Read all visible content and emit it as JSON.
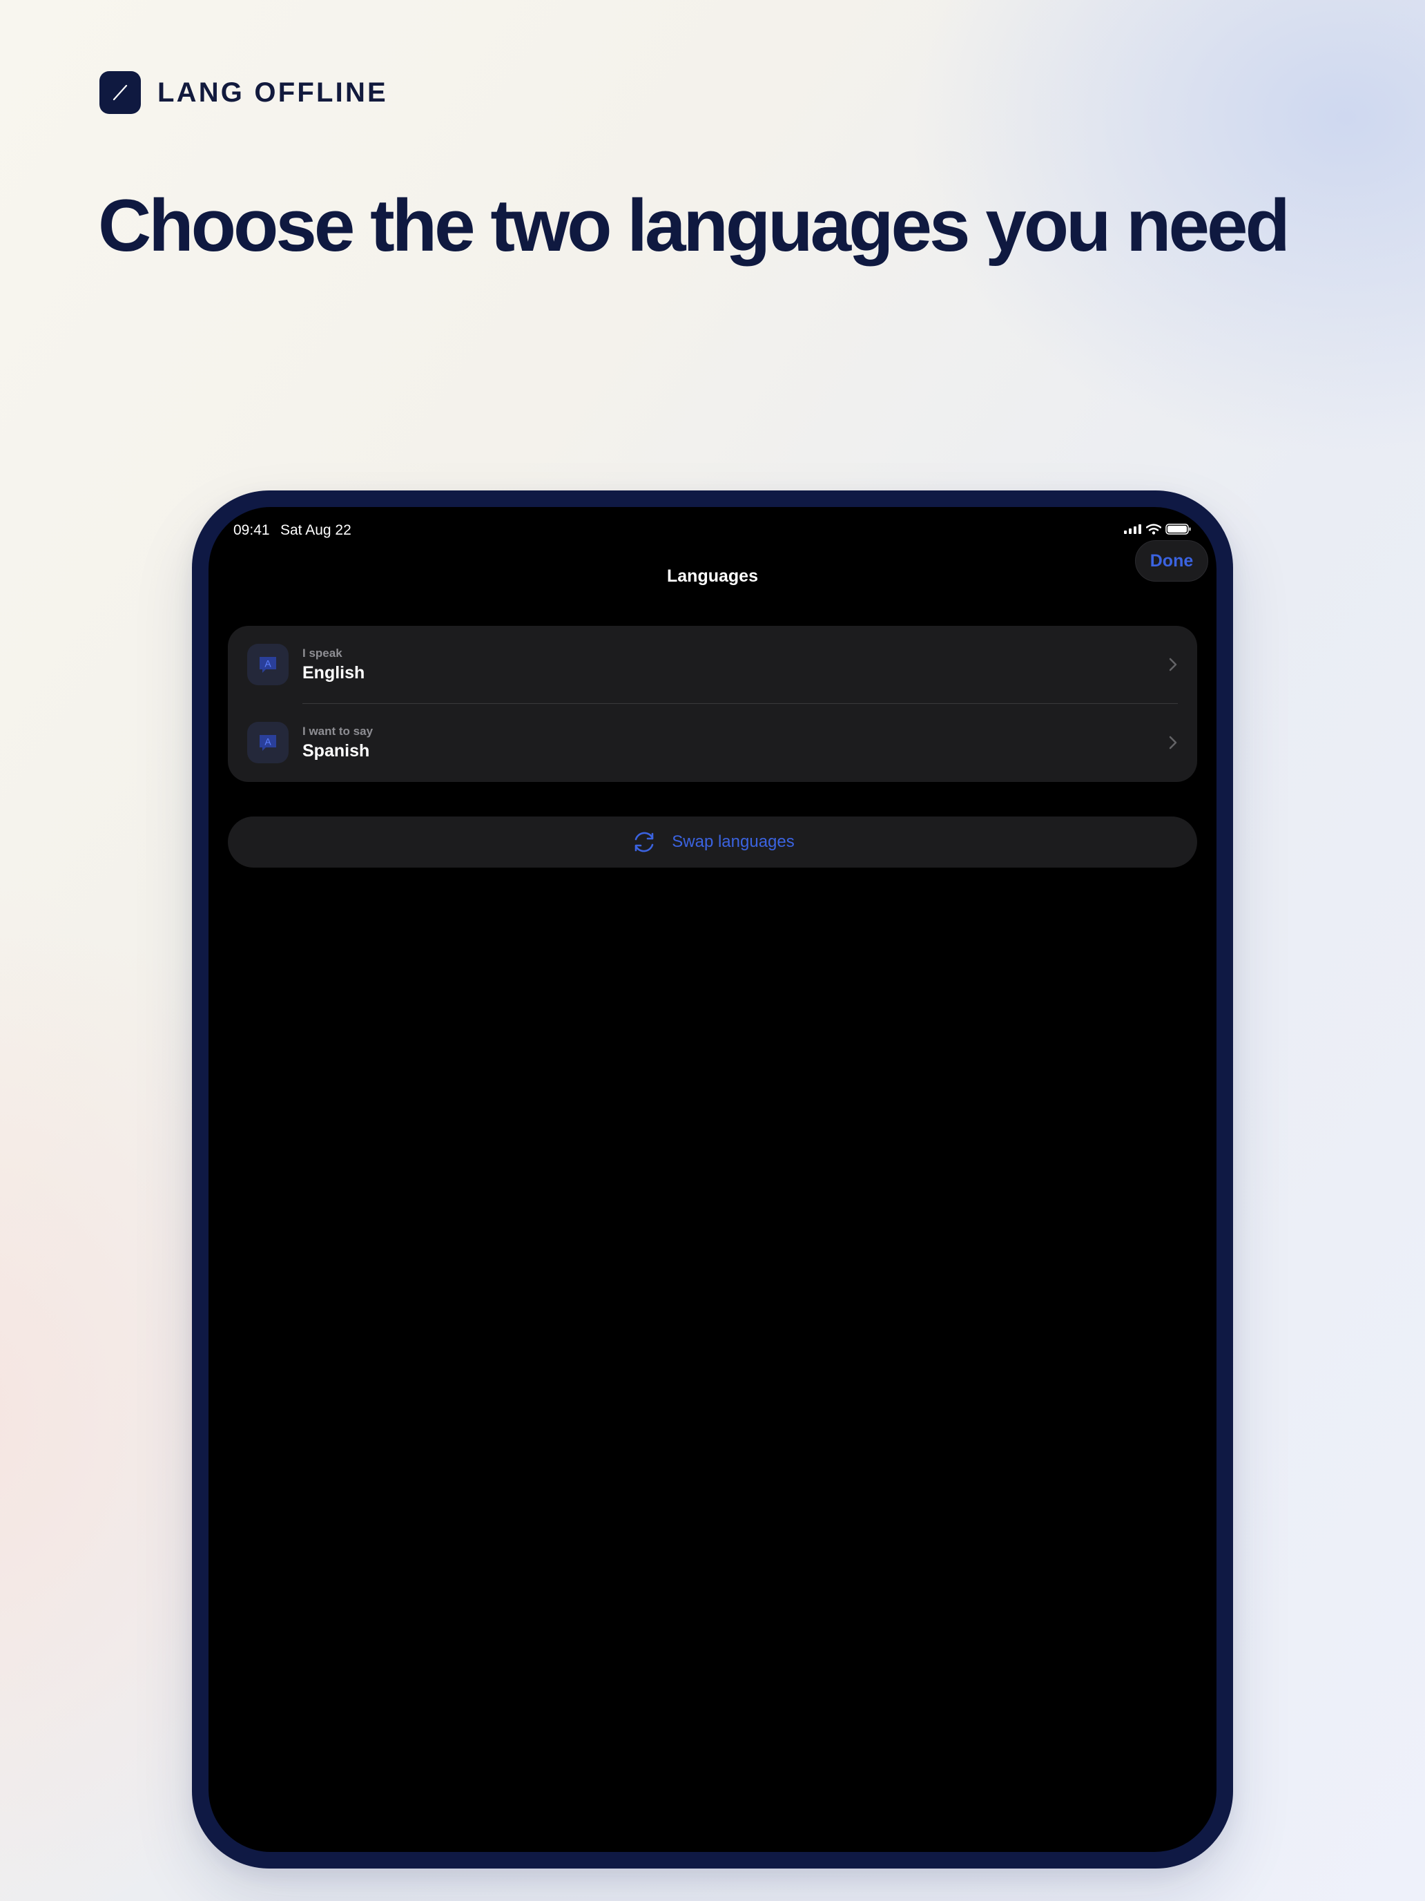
{
  "brand": {
    "name": "LANG OFFLINE",
    "logo_icon": "quill-stroke-icon"
  },
  "headline": "Choose the two languages you need",
  "device": {
    "status_bar": {
      "time": "09:41",
      "date": "Sat Aug 22",
      "icons": [
        "cellular-signal-icon",
        "wifi-icon",
        "battery-icon"
      ]
    },
    "nav": {
      "title": "Languages",
      "done_label": "Done"
    },
    "languages": [
      {
        "caption": "I speak",
        "value": "English",
        "icon": "translate-bubble-icon"
      },
      {
        "caption": "I want to say",
        "value": "Spanish",
        "icon": "translate-bubble-icon"
      }
    ],
    "swap_label": "Swap languages",
    "swap_icon": "swap-arrows-icon"
  },
  "colors": {
    "brand_navy": "#0f1940",
    "accent_blue": "#3b63e0",
    "card_background": "#1c1c1e",
    "screen_background": "#000000"
  }
}
